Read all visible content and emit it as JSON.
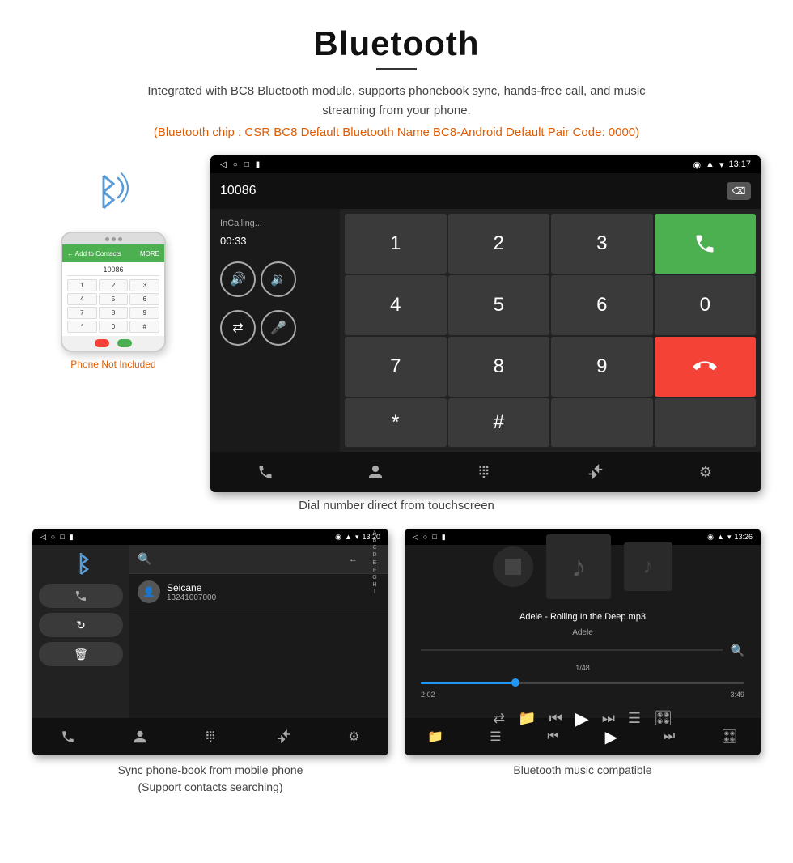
{
  "header": {
    "title": "Bluetooth",
    "description": "Integrated with BC8 Bluetooth module, supports phonebook sync, hands-free call, and music streaming from your phone.",
    "highlight": "(Bluetooth chip : CSR BC8    Default Bluetooth Name BC8-Android    Default Pair Code: 0000)"
  },
  "phone_mockup": {
    "not_included": "Phone Not Included",
    "number": "10086",
    "keys": [
      "1",
      "2",
      "3",
      "4",
      "5",
      "6",
      "7",
      "8",
      "9",
      "*",
      "0",
      "#"
    ]
  },
  "dialer_screen": {
    "time": "13:17",
    "number": "10086",
    "status": "InCalling...",
    "timer": "00:33",
    "keys": [
      "1",
      "2",
      "3",
      "*",
      "4",
      "5",
      "6",
      "0",
      "7",
      "8",
      "9",
      "#"
    ],
    "caption": "Dial number direct from touchscreen"
  },
  "phonebook_screen": {
    "time": "13:20",
    "contact_name": "Seicane",
    "contact_number": "13241007000",
    "alphabet": [
      "*",
      "A",
      "B",
      "C",
      "D",
      "E",
      "F",
      "G",
      "H",
      "I"
    ],
    "caption_line1": "Sync phone-book from mobile phone",
    "caption_line2": "(Support contacts searching)"
  },
  "music_screen": {
    "time": "13:26",
    "track": "Adele - Rolling In the Deep.mp3",
    "artist": "Adele",
    "track_count": "1/48",
    "time_current": "2:02",
    "time_total": "3:49",
    "caption": "Bluetooth music compatible"
  },
  "nav_icons": {
    "back": "◁",
    "home": "○",
    "recent": "□",
    "phone": "☎",
    "contacts": "👤",
    "keypad": "⠿",
    "transfer": "⇄",
    "settings": "⚙"
  }
}
